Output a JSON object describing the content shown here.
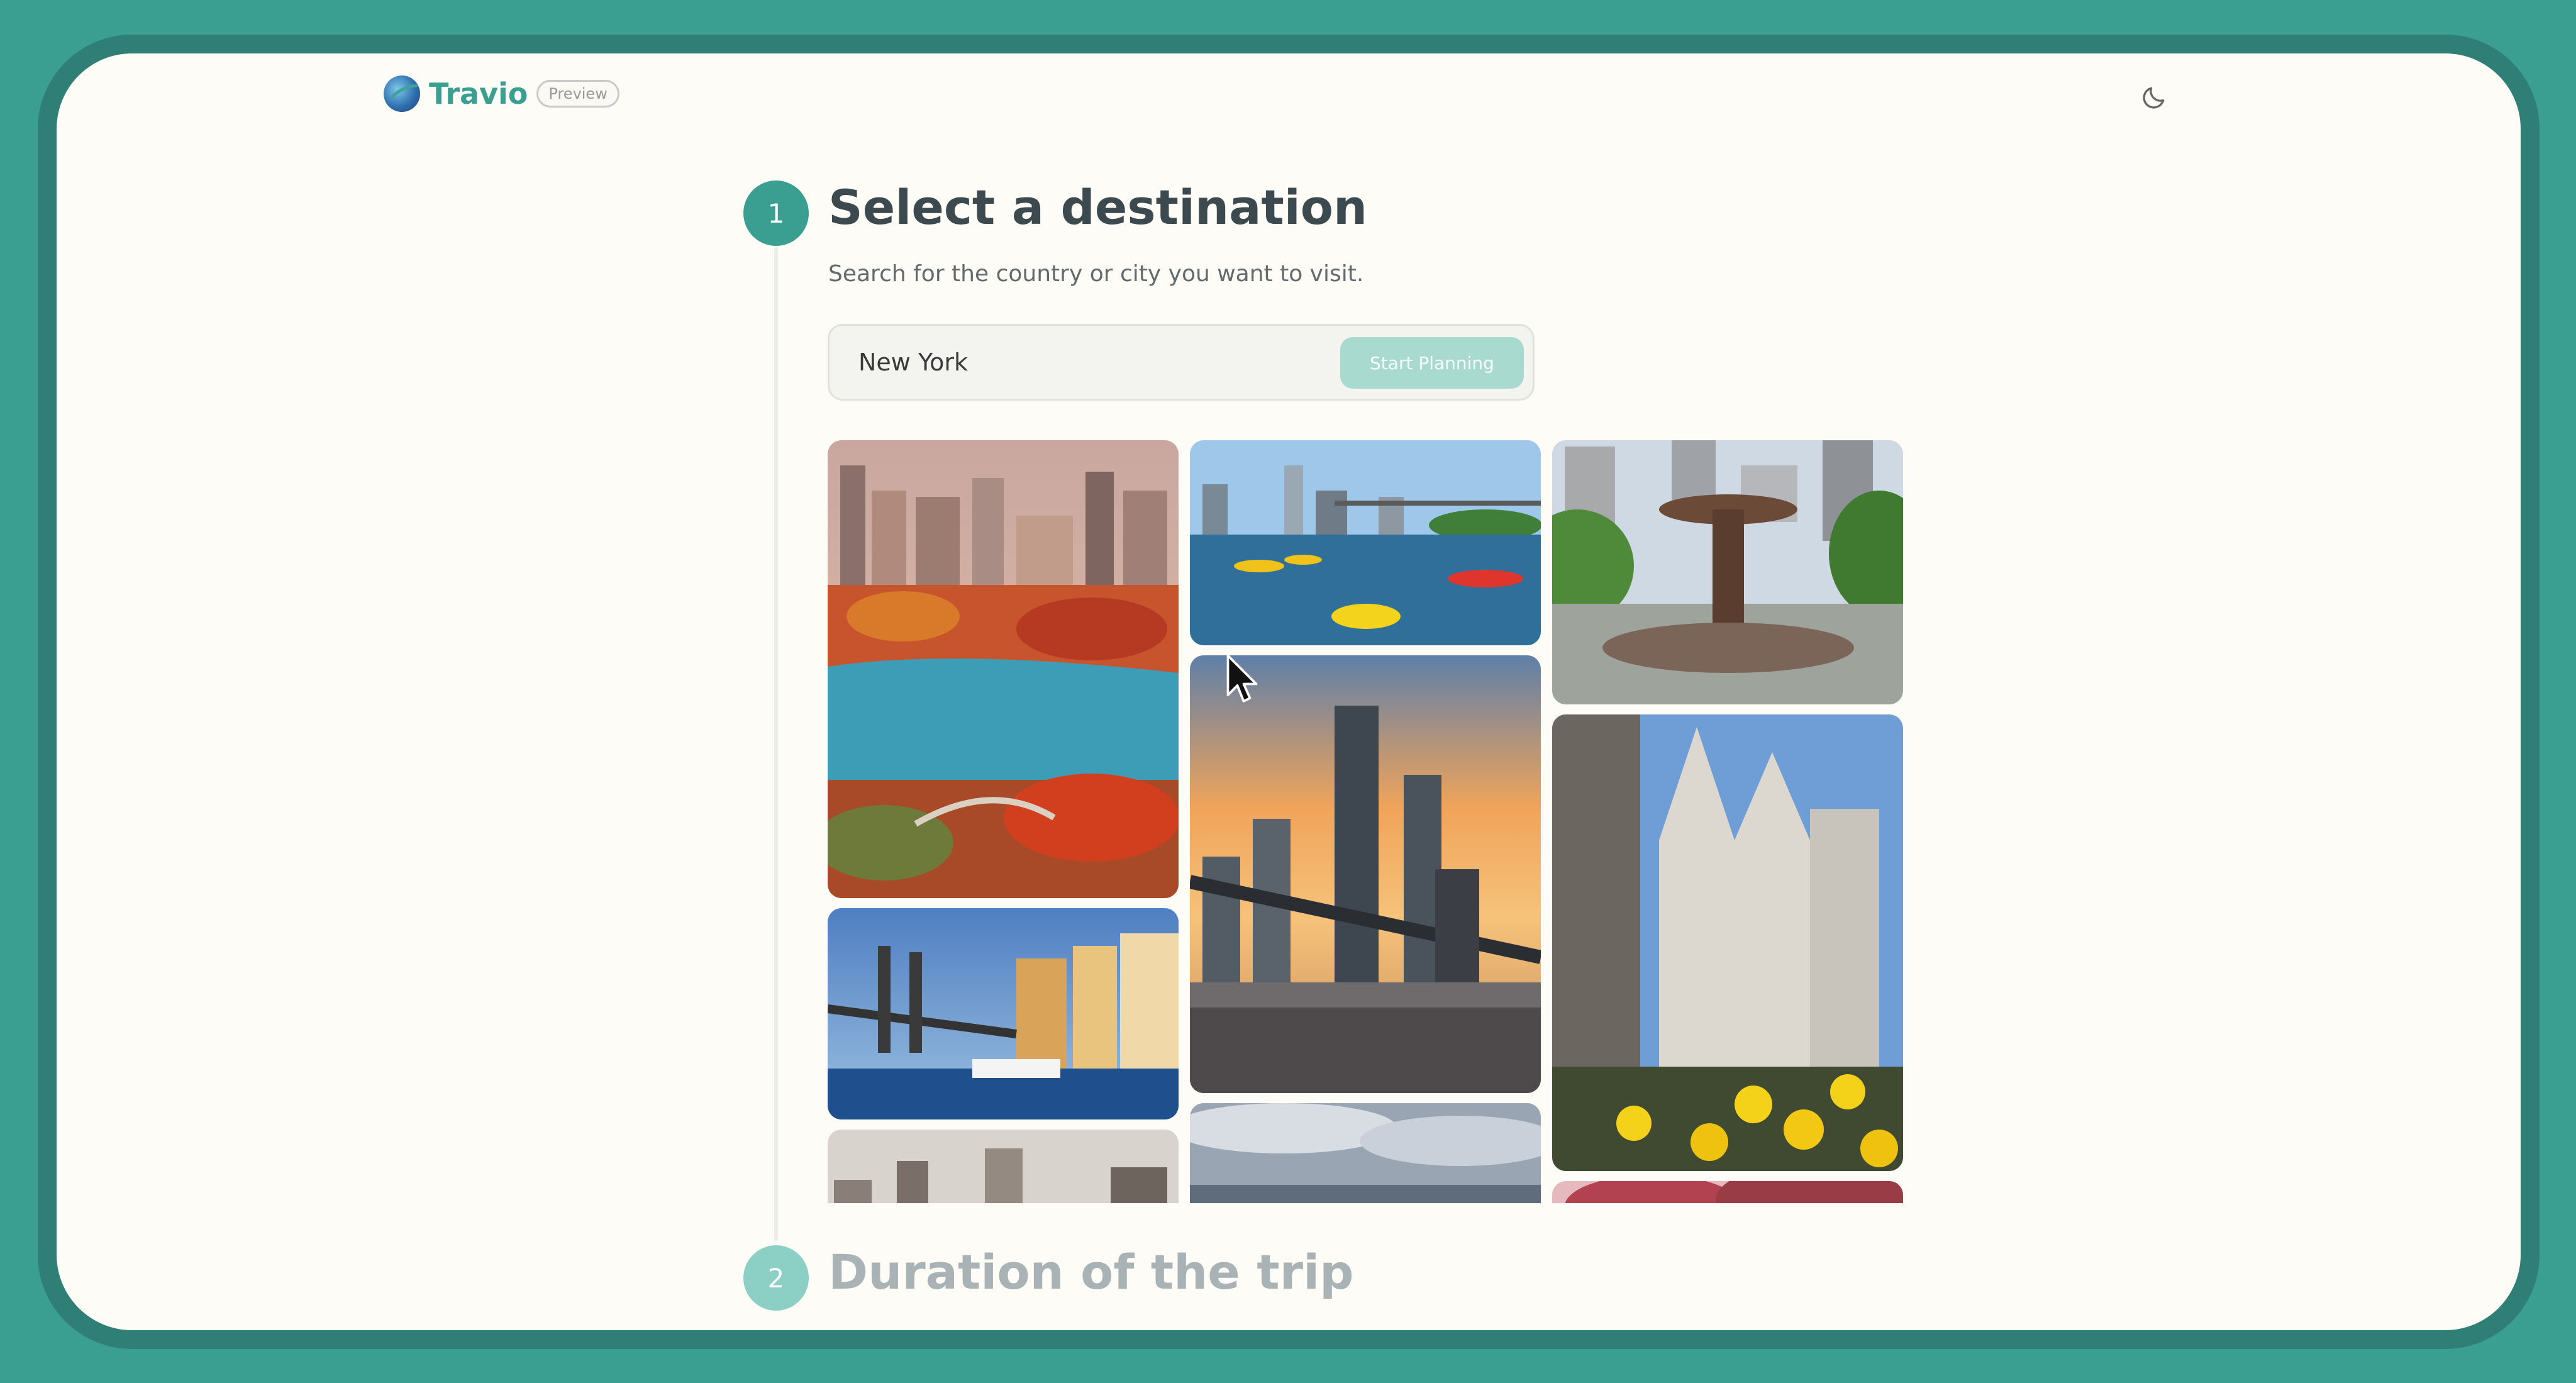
{
  "header": {
    "brand_name": "Travio",
    "badge": "Preview",
    "logo_icon": "globe-plane-icon",
    "theme_icon": "moon-icon"
  },
  "step1": {
    "number": "1",
    "title": "Select a destination",
    "subtitle": "Search for the country or city you want to visit.",
    "search_value": "New York",
    "search_button": "Start Planning"
  },
  "step2": {
    "number": "2",
    "title": "Duration of the trip"
  },
  "colors": {
    "accent": "#3a9e91",
    "accent_light": "#a9dacf",
    "background": "#fdfcf7",
    "heading": "#3c4a50"
  }
}
